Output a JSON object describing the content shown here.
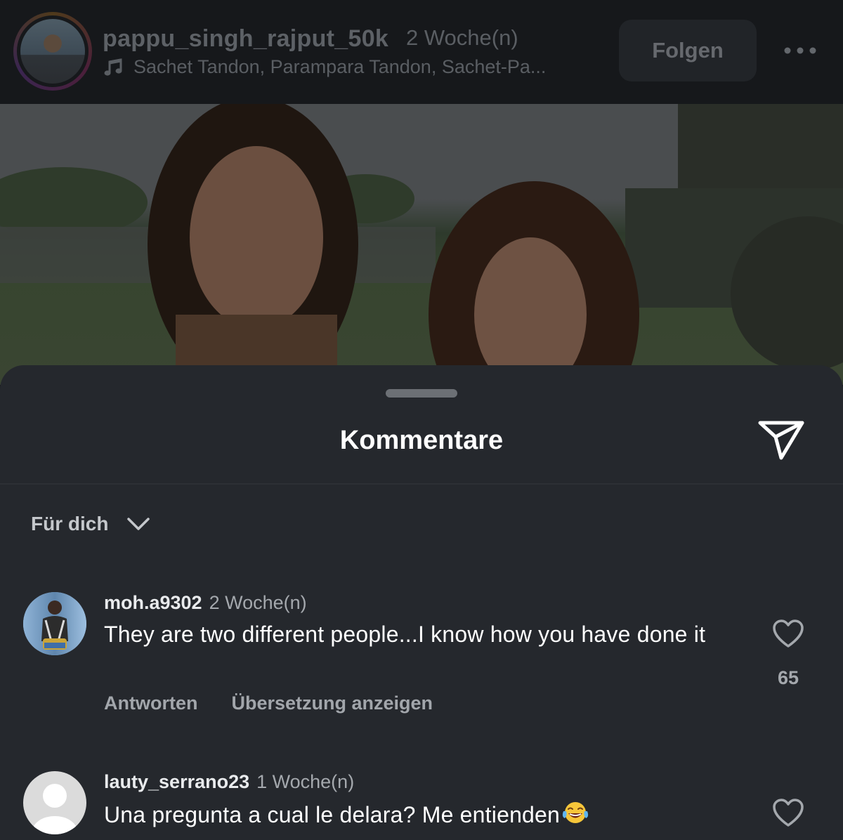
{
  "post_header": {
    "username": "pappu_singh_rajput_50k",
    "time": "2 Woche(n)",
    "music": "Sachet Tandon, Parampara Tandon, Sachet-Pa...",
    "follow_label": "Folgen",
    "icons": {
      "music": "music-note-icon",
      "more": "more-dots-icon"
    }
  },
  "comments_sheet": {
    "title": "Kommentare",
    "share_icon": "paper-plane-icon",
    "sort_label": "Für dich",
    "comments": [
      {
        "username": "moh.a9302",
        "time": "2 Woche(n)",
        "text": "They are two different people...I know how you have done it",
        "likes": "65",
        "reply_label": "Antworten",
        "translate_label": "Übersetzung anzeigen"
      },
      {
        "username": "lauty_serrano23",
        "time": "1 Woche(n)",
        "text": "Una pregunta a cual le delara? Me entienden",
        "emoji": "laughing-tears-emoji"
      }
    ]
  },
  "colors": {
    "sheet_background": "#25282d",
    "header_background": "#16181b",
    "primary_text": "#ffffff",
    "secondary_text": "#a4a8ad"
  }
}
